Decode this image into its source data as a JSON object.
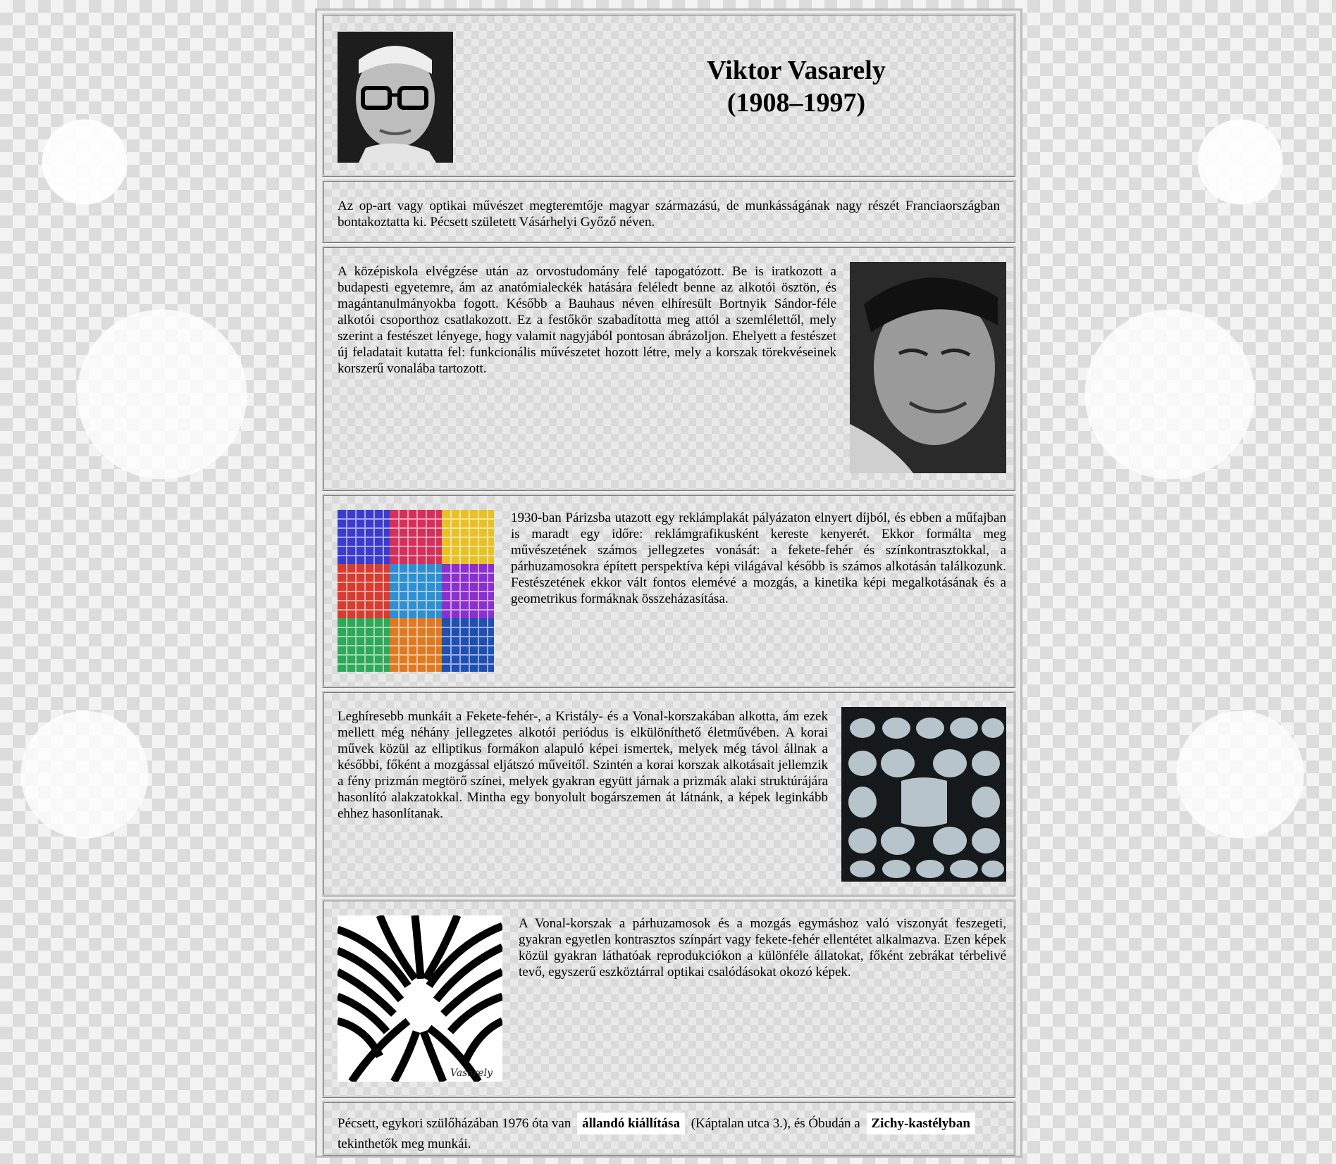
{
  "header": {
    "name": "Viktor Vasarely",
    "years": "(1908–1997)"
  },
  "intro": {
    "text": "Az op-art vagy optikai művészet megteremtője magyar származású, de munkásságának nagy részét Franciaországban bontakoztatta ki. Pécsett született Vásárhelyi Győző néven."
  },
  "sections": [
    {
      "text": "A középiskola elvégzése után az orvostudomány felé tapogatózott. Be is iratkozott a budapesti egyetemre, ám az anatómialeckék hatására feléledt benne az alkotói ösztön, és magántanulmányokba fogott. Később a Bauhaus néven elhíresült Bortnyik Sándor-féle alkotói csoporthoz csatlakozott. Ez a festőkör szabadította meg attól a szemlélettől, mely szerint a festészet lényege, hogy valamit nagyjából pontosan ábrázoljon. Ehelyett a festészet új feladatait kutatta fel: funkcionális művészetet hozott létre, mely a korszak törekvéseinek korszerű vonalába tartozott."
    },
    {
      "text": "1930-ban Párizsba utazott egy reklámplakát pályázaton elnyert díjból, és ebben a műfajban is maradt egy időre: reklámgrafikusként kereste kenyerét. Ekkor formálta meg művészetének számos jellegzetes vonását: a fekete-fehér és színkontrasztokkal, a párhuzamosokra épített perspektíva képi világával később is számos alkotásán találkozunk. Festészetének ekkor vált fontos elemévé a mozgás, a kinetika képi megalkotásának és a geometrikus formáknak összeházasítása."
    },
    {
      "text": "Leghíresebb munkáit a Fekete-fehér-, a Kristály- és a Vonal-korszakában alkotta, ám ezek mellett még néhány jellegzetes alkotói periódus is elkülöníthető életművében. A korai művek közül az elliptikus formákon alapuló képei ismertek, melyek még távol állnak a későbbi, főként a mozgással eljátszó műveitől. Szintén a korai korszak alkotásait jellemzik a fény prizmán megtörő színei, melyek gyakran együtt járnak a prizmák alaki struktúrájára hasonlító alakzatokkal. Mintha egy bonyolult bogárszemen át látnánk, a képek leginkább ehhez hasonlítanak."
    },
    {
      "text": "A Vonal-korszak a párhuzamosok és a mozgás egymáshoz való viszonyát feszegeti, gyakran egyetlen kontrasztos színpárt vagy fekete-fehér ellentétet alkalmazva. Ezen képek közül gyakran láthatóak reprodukciókon a különféle állatokat, főként zebrákat térbelivé tevő, egyszerű eszköztárral optikai csalódásokat okozó képek."
    }
  ],
  "footer": {
    "text_before": "Pécsett, egykori szülőházában 1976 óta van",
    "link1": "állandó kiállítása",
    "text_middle": "(Káptalan utca 3.), és Óbudán a",
    "link2": "Zichy-kastélyban",
    "text_after": "tekinthetők meg munkái."
  },
  "artwork_signature": "Vasarely"
}
